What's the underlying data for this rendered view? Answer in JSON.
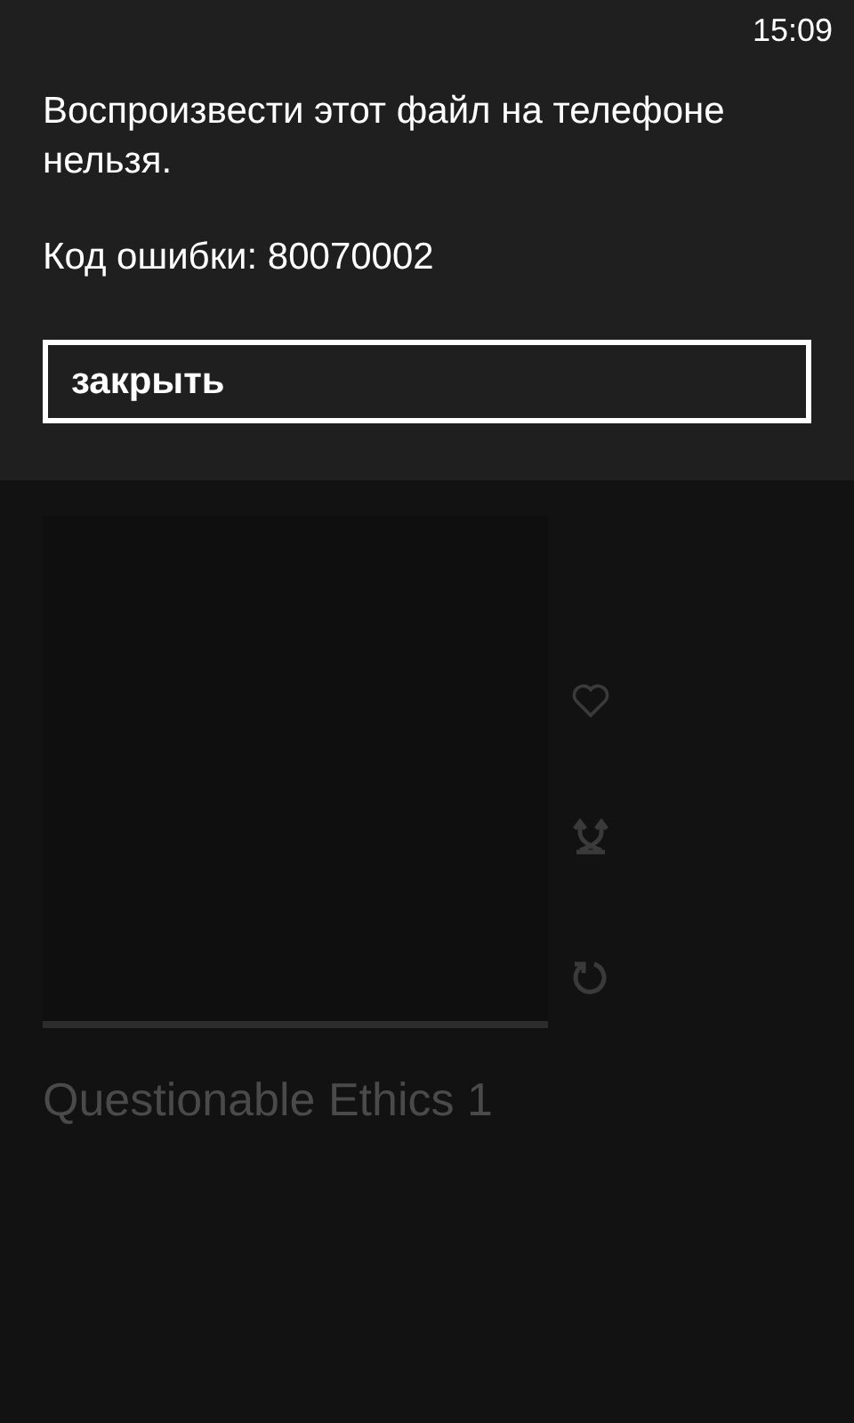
{
  "status_bar": {
    "time": "15:09"
  },
  "dialog": {
    "message": "Воспроизвести этот файл на телефоне нельзя.",
    "error": "Код ошибки: 80070002",
    "button": "закрыть"
  },
  "player": {
    "track": "Questionable Ethics 1"
  }
}
